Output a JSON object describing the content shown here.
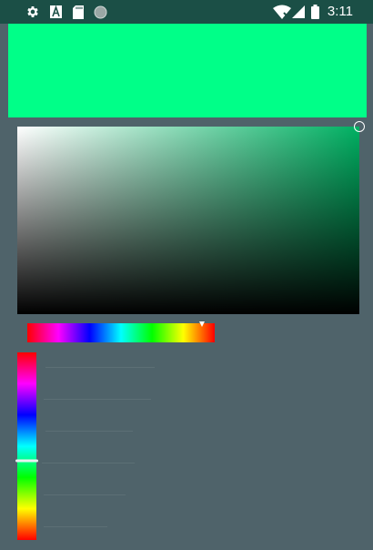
{
  "status_bar": {
    "time": "3:11",
    "icons": [
      "settings-icon",
      "text-a-icon",
      "sd-card-icon",
      "sync-circle-icon",
      "wifi-off-icon",
      "cell-signal-icon",
      "battery-icon"
    ]
  },
  "color": {
    "selected_hex": "#00ff88",
    "hue_base_hex": "#00b062"
  },
  "saturation_value_picker": {
    "saturation": 1.0,
    "value": 1.0
  },
  "hue_slider_horizontal": {
    "value": 0.93
  },
  "hue_slider_vertical": {
    "value": 0.58
  }
}
